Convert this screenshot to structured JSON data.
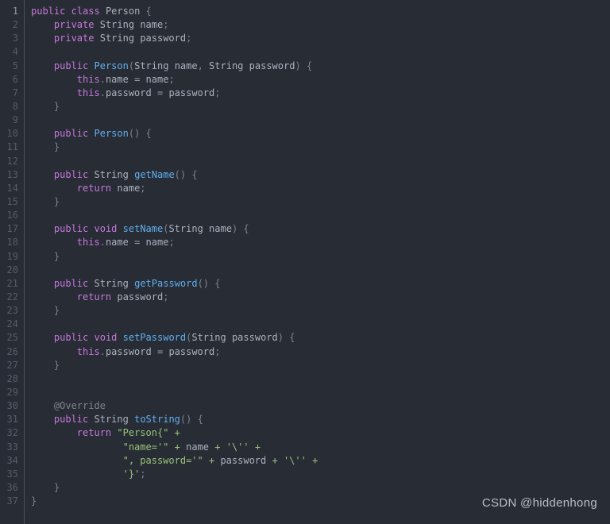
{
  "editor": {
    "language": "java",
    "background_color": "#282c34",
    "gutter_separator_color": "#4b515c",
    "first_line": 1,
    "last_line": 37,
    "total_lines": 37,
    "line_numbers": [
      "1",
      "2",
      "3",
      "4",
      "5",
      "6",
      "7",
      "8",
      "9",
      "10",
      "11",
      "12",
      "13",
      "14",
      "15",
      "16",
      "17",
      "18",
      "19",
      "20",
      "21",
      "22",
      "23",
      "24",
      "25",
      "26",
      "27",
      "28",
      "29",
      "30",
      "31",
      "32",
      "33",
      "34",
      "35",
      "36",
      "37"
    ],
    "active_line": 1,
    "theme_colors": {
      "keyword": "#c678dd",
      "function": "#61afef",
      "string": "#98c379",
      "identifier": "#abb2bf",
      "punctuation": "#7b8494",
      "operator": "#9aa0ab",
      "annotation": "#7f848e",
      "line_number": "#555d6b",
      "line_number_active": "#8d97a8"
    },
    "lines": [
      {
        "n": "1",
        "tokens": [
          {
            "t": "public",
            "c": "kw"
          },
          {
            "t": " ",
            "c": "plain"
          },
          {
            "t": "class",
            "c": "kw"
          },
          {
            "t": " ",
            "c": "plain"
          },
          {
            "t": "Person",
            "c": "cls"
          },
          {
            "t": " ",
            "c": "plain"
          },
          {
            "t": "{",
            "c": "punc"
          }
        ]
      },
      {
        "n": "2",
        "tokens": [
          {
            "t": "    ",
            "c": "plain"
          },
          {
            "t": "private",
            "c": "kw"
          },
          {
            "t": " ",
            "c": "plain"
          },
          {
            "t": "String",
            "c": "type"
          },
          {
            "t": " ",
            "c": "plain"
          },
          {
            "t": "name",
            "c": "type"
          },
          {
            "t": ";",
            "c": "punc"
          }
        ]
      },
      {
        "n": "3",
        "tokens": [
          {
            "t": "    ",
            "c": "plain"
          },
          {
            "t": "private",
            "c": "kw"
          },
          {
            "t": " ",
            "c": "plain"
          },
          {
            "t": "String",
            "c": "type"
          },
          {
            "t": " ",
            "c": "plain"
          },
          {
            "t": "password",
            "c": "type"
          },
          {
            "t": ";",
            "c": "punc"
          }
        ]
      },
      {
        "n": "4",
        "tokens": []
      },
      {
        "n": "5",
        "tokens": [
          {
            "t": "    ",
            "c": "plain"
          },
          {
            "t": "public",
            "c": "kw"
          },
          {
            "t": " ",
            "c": "plain"
          },
          {
            "t": "Person",
            "c": "fn"
          },
          {
            "t": "(",
            "c": "punc"
          },
          {
            "t": "String",
            "c": "type"
          },
          {
            "t": " ",
            "c": "plain"
          },
          {
            "t": "name",
            "c": "type"
          },
          {
            "t": ", ",
            "c": "punc"
          },
          {
            "t": "String",
            "c": "type"
          },
          {
            "t": " ",
            "c": "plain"
          },
          {
            "t": "password",
            "c": "type"
          },
          {
            "t": ")",
            "c": "punc"
          },
          {
            "t": " ",
            "c": "plain"
          },
          {
            "t": "{",
            "c": "punc"
          }
        ]
      },
      {
        "n": "6",
        "tokens": [
          {
            "t": "        ",
            "c": "plain"
          },
          {
            "t": "this",
            "c": "kw"
          },
          {
            "t": ".",
            "c": "punc"
          },
          {
            "t": "name",
            "c": "type"
          },
          {
            "t": " ",
            "c": "plain"
          },
          {
            "t": "=",
            "c": "op"
          },
          {
            "t": " ",
            "c": "plain"
          },
          {
            "t": "name",
            "c": "type"
          },
          {
            "t": ";",
            "c": "punc"
          }
        ]
      },
      {
        "n": "7",
        "tokens": [
          {
            "t": "        ",
            "c": "plain"
          },
          {
            "t": "this",
            "c": "kw"
          },
          {
            "t": ".",
            "c": "punc"
          },
          {
            "t": "password",
            "c": "type"
          },
          {
            "t": " ",
            "c": "plain"
          },
          {
            "t": "=",
            "c": "op"
          },
          {
            "t": " ",
            "c": "plain"
          },
          {
            "t": "password",
            "c": "type"
          },
          {
            "t": ";",
            "c": "punc"
          }
        ]
      },
      {
        "n": "8",
        "tokens": [
          {
            "t": "    ",
            "c": "plain"
          },
          {
            "t": "}",
            "c": "punc"
          }
        ]
      },
      {
        "n": "9",
        "tokens": []
      },
      {
        "n": "10",
        "tokens": [
          {
            "t": "    ",
            "c": "plain"
          },
          {
            "t": "public",
            "c": "kw"
          },
          {
            "t": " ",
            "c": "plain"
          },
          {
            "t": "Person",
            "c": "fn"
          },
          {
            "t": "()",
            "c": "punc"
          },
          {
            "t": " ",
            "c": "plain"
          },
          {
            "t": "{",
            "c": "punc"
          }
        ]
      },
      {
        "n": "11",
        "tokens": [
          {
            "t": "    ",
            "c": "plain"
          },
          {
            "t": "}",
            "c": "punc"
          }
        ]
      },
      {
        "n": "12",
        "tokens": []
      },
      {
        "n": "13",
        "tokens": [
          {
            "t": "    ",
            "c": "plain"
          },
          {
            "t": "public",
            "c": "kw"
          },
          {
            "t": " ",
            "c": "plain"
          },
          {
            "t": "String",
            "c": "type"
          },
          {
            "t": " ",
            "c": "plain"
          },
          {
            "t": "getName",
            "c": "fn"
          },
          {
            "t": "()",
            "c": "punc"
          },
          {
            "t": " ",
            "c": "plain"
          },
          {
            "t": "{",
            "c": "punc"
          }
        ]
      },
      {
        "n": "14",
        "tokens": [
          {
            "t": "        ",
            "c": "plain"
          },
          {
            "t": "return",
            "c": "kw"
          },
          {
            "t": " ",
            "c": "plain"
          },
          {
            "t": "name",
            "c": "type"
          },
          {
            "t": ";",
            "c": "punc"
          }
        ]
      },
      {
        "n": "15",
        "tokens": [
          {
            "t": "    ",
            "c": "plain"
          },
          {
            "t": "}",
            "c": "punc"
          }
        ]
      },
      {
        "n": "16",
        "tokens": []
      },
      {
        "n": "17",
        "tokens": [
          {
            "t": "    ",
            "c": "plain"
          },
          {
            "t": "public",
            "c": "kw"
          },
          {
            "t": " ",
            "c": "plain"
          },
          {
            "t": "void",
            "c": "kw"
          },
          {
            "t": " ",
            "c": "plain"
          },
          {
            "t": "setName",
            "c": "fn"
          },
          {
            "t": "(",
            "c": "punc"
          },
          {
            "t": "String",
            "c": "type"
          },
          {
            "t": " ",
            "c": "plain"
          },
          {
            "t": "name",
            "c": "type"
          },
          {
            "t": ")",
            "c": "punc"
          },
          {
            "t": " ",
            "c": "plain"
          },
          {
            "t": "{",
            "c": "punc"
          }
        ]
      },
      {
        "n": "18",
        "tokens": [
          {
            "t": "        ",
            "c": "plain"
          },
          {
            "t": "this",
            "c": "kw"
          },
          {
            "t": ".",
            "c": "punc"
          },
          {
            "t": "name",
            "c": "type"
          },
          {
            "t": " ",
            "c": "plain"
          },
          {
            "t": "=",
            "c": "op"
          },
          {
            "t": " ",
            "c": "plain"
          },
          {
            "t": "name",
            "c": "type"
          },
          {
            "t": ";",
            "c": "punc"
          }
        ]
      },
      {
        "n": "19",
        "tokens": [
          {
            "t": "    ",
            "c": "plain"
          },
          {
            "t": "}",
            "c": "punc"
          }
        ]
      },
      {
        "n": "20",
        "tokens": []
      },
      {
        "n": "21",
        "tokens": [
          {
            "t": "    ",
            "c": "plain"
          },
          {
            "t": "public",
            "c": "kw"
          },
          {
            "t": " ",
            "c": "plain"
          },
          {
            "t": "String",
            "c": "type"
          },
          {
            "t": " ",
            "c": "plain"
          },
          {
            "t": "getPassword",
            "c": "fn"
          },
          {
            "t": "()",
            "c": "punc"
          },
          {
            "t": " ",
            "c": "plain"
          },
          {
            "t": "{",
            "c": "punc"
          }
        ]
      },
      {
        "n": "22",
        "tokens": [
          {
            "t": "        ",
            "c": "plain"
          },
          {
            "t": "return",
            "c": "kw"
          },
          {
            "t": " ",
            "c": "plain"
          },
          {
            "t": "password",
            "c": "type"
          },
          {
            "t": ";",
            "c": "punc"
          }
        ]
      },
      {
        "n": "23",
        "tokens": [
          {
            "t": "    ",
            "c": "plain"
          },
          {
            "t": "}",
            "c": "punc"
          }
        ]
      },
      {
        "n": "24",
        "tokens": []
      },
      {
        "n": "25",
        "tokens": [
          {
            "t": "    ",
            "c": "plain"
          },
          {
            "t": "public",
            "c": "kw"
          },
          {
            "t": " ",
            "c": "plain"
          },
          {
            "t": "void",
            "c": "kw"
          },
          {
            "t": " ",
            "c": "plain"
          },
          {
            "t": "setPassword",
            "c": "fn"
          },
          {
            "t": "(",
            "c": "punc"
          },
          {
            "t": "String",
            "c": "type"
          },
          {
            "t": " ",
            "c": "plain"
          },
          {
            "t": "password",
            "c": "type"
          },
          {
            "t": ")",
            "c": "punc"
          },
          {
            "t": " ",
            "c": "plain"
          },
          {
            "t": "{",
            "c": "punc"
          }
        ]
      },
      {
        "n": "26",
        "tokens": [
          {
            "t": "        ",
            "c": "plain"
          },
          {
            "t": "this",
            "c": "kw"
          },
          {
            "t": ".",
            "c": "punc"
          },
          {
            "t": "password",
            "c": "type"
          },
          {
            "t": " ",
            "c": "plain"
          },
          {
            "t": "=",
            "c": "op"
          },
          {
            "t": " ",
            "c": "plain"
          },
          {
            "t": "password",
            "c": "type"
          },
          {
            "t": ";",
            "c": "punc"
          }
        ]
      },
      {
        "n": "27",
        "tokens": [
          {
            "t": "    ",
            "c": "plain"
          },
          {
            "t": "}",
            "c": "punc"
          }
        ]
      },
      {
        "n": "28",
        "tokens": []
      },
      {
        "n": "29",
        "tokens": []
      },
      {
        "n": "30",
        "tokens": [
          {
            "t": "    ",
            "c": "plain"
          },
          {
            "t": "@Override",
            "c": "ann"
          }
        ]
      },
      {
        "n": "31",
        "tokens": [
          {
            "t": "    ",
            "c": "plain"
          },
          {
            "t": "public",
            "c": "kw"
          },
          {
            "t": " ",
            "c": "plain"
          },
          {
            "t": "String",
            "c": "type"
          },
          {
            "t": " ",
            "c": "plain"
          },
          {
            "t": "toString",
            "c": "fn"
          },
          {
            "t": "()",
            "c": "punc"
          },
          {
            "t": " ",
            "c": "plain"
          },
          {
            "t": "{",
            "c": "punc"
          }
        ]
      },
      {
        "n": "32",
        "tokens": [
          {
            "t": "        ",
            "c": "plain"
          },
          {
            "t": "return",
            "c": "kw"
          },
          {
            "t": " ",
            "c": "plain"
          },
          {
            "t": "\"Person{\"",
            "c": "str"
          },
          {
            "t": " ",
            "c": "plain"
          },
          {
            "t": "+",
            "c": "str"
          }
        ]
      },
      {
        "n": "33",
        "tokens": [
          {
            "t": "                ",
            "c": "plain"
          },
          {
            "t": "\"name='\"",
            "c": "str"
          },
          {
            "t": " ",
            "c": "plain"
          },
          {
            "t": "+",
            "c": "str"
          },
          {
            "t": " ",
            "c": "plain"
          },
          {
            "t": "name",
            "c": "type"
          },
          {
            "t": " ",
            "c": "plain"
          },
          {
            "t": "+",
            "c": "str"
          },
          {
            "t": " ",
            "c": "plain"
          },
          {
            "t": "'\\''",
            "c": "str"
          },
          {
            "t": " ",
            "c": "plain"
          },
          {
            "t": "+",
            "c": "str"
          }
        ]
      },
      {
        "n": "34",
        "tokens": [
          {
            "t": "                ",
            "c": "plain"
          },
          {
            "t": "\", password='\"",
            "c": "str"
          },
          {
            "t": " ",
            "c": "plain"
          },
          {
            "t": "+",
            "c": "str"
          },
          {
            "t": " ",
            "c": "plain"
          },
          {
            "t": "password",
            "c": "type"
          },
          {
            "t": " ",
            "c": "plain"
          },
          {
            "t": "+",
            "c": "str"
          },
          {
            "t": " ",
            "c": "plain"
          },
          {
            "t": "'\\''",
            "c": "str"
          },
          {
            "t": " ",
            "c": "plain"
          },
          {
            "t": "+",
            "c": "str"
          }
        ]
      },
      {
        "n": "35",
        "tokens": [
          {
            "t": "                ",
            "c": "plain"
          },
          {
            "t": "'}'",
            "c": "str"
          },
          {
            "t": ";",
            "c": "punc"
          }
        ]
      },
      {
        "n": "36",
        "tokens": [
          {
            "t": "    ",
            "c": "plain"
          },
          {
            "t": "}",
            "c": "punc"
          }
        ]
      },
      {
        "n": "37",
        "tokens": [
          {
            "t": "}",
            "c": "punc"
          }
        ]
      }
    ]
  },
  "watermark": {
    "text": "CSDN @hiddenhong",
    "color": "#b9bfc9"
  }
}
